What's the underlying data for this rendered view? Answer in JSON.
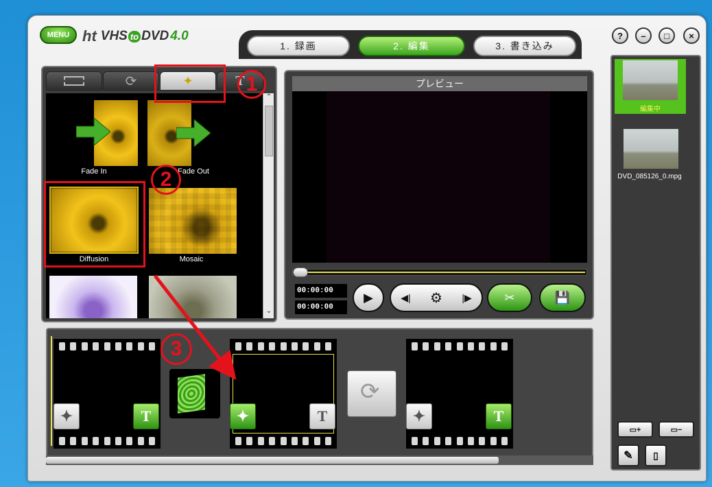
{
  "app": {
    "menu_label": "MENU",
    "logo": {
      "ht": "ht",
      "vhs": "VHS",
      "to": "to",
      "dvd": "DVD",
      "version": "4.0"
    }
  },
  "steps": [
    {
      "label": "1. 録画",
      "active": false
    },
    {
      "label": "2. 編集",
      "active": true
    },
    {
      "label": "3. 書き込み",
      "active": false
    }
  ],
  "window_controls": {
    "help": "?",
    "minimize": "–",
    "maximize": "□",
    "close": "×"
  },
  "effect_tabs": [
    {
      "icon": "film-strip-icon"
    },
    {
      "icon": "transition-swirl-icon"
    },
    {
      "icon": "magic-wand-icon",
      "selected": true
    },
    {
      "icon": "text-t-icon",
      "glyph": "T"
    }
  ],
  "effects": [
    {
      "label": "Fade In"
    },
    {
      "label": "Fade Out"
    },
    {
      "label": "Diffusion"
    },
    {
      "label": "Mosaic"
    }
  ],
  "preview": {
    "title": "プレビュー",
    "timecode_current": "00:00:00",
    "timecode_total": "00:00:00"
  },
  "sidebar": {
    "clips": [
      {
        "label": "編集中",
        "selected": true
      },
      {
        "label": "DVD_085126_0.mpg",
        "selected": false
      }
    ]
  },
  "annotations": {
    "n1": "1",
    "n2": "2",
    "n3": "3"
  },
  "colors": {
    "accent_green": "#3ba51c",
    "annotation_red": "#e4121b",
    "highlight_yellow": "#e8e050"
  }
}
